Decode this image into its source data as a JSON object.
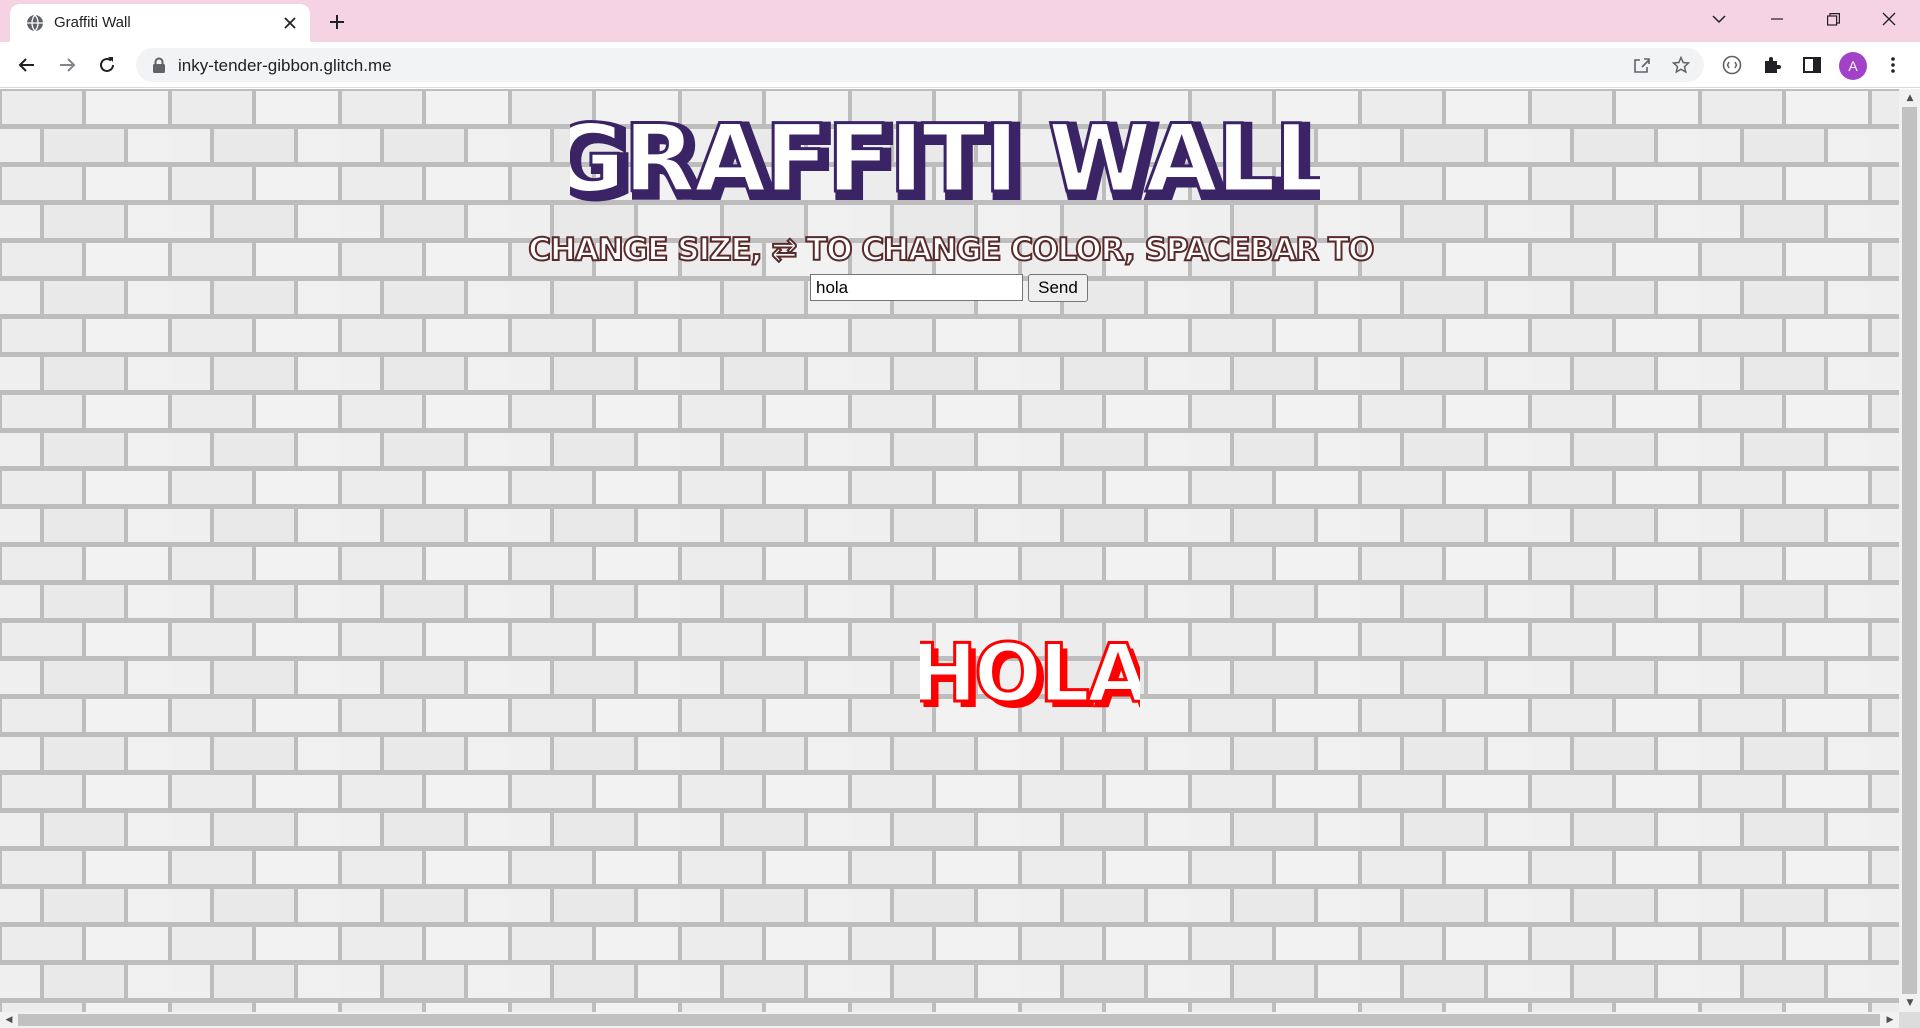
{
  "browser": {
    "tab": {
      "title": "Graffiti Wall",
      "favicon": "globe-icon",
      "close_icon": "close-icon"
    },
    "new_tab_icon": "plus-icon",
    "window_controls": [
      "chevron-down-icon",
      "minimize-icon",
      "restore-icon",
      "close-icon"
    ],
    "nav": [
      "back-icon",
      "forward-icon",
      "reload-icon"
    ],
    "url": "inky-tender-gibbon.glitch.me",
    "omnibox_icons": [
      "share-icon",
      "star-icon"
    ],
    "toolbar_icons": [
      "extension-circle-icon",
      "puzzle-icon",
      "side-panel-icon"
    ],
    "avatar_letter": "A",
    "colors": {
      "tabstrip": "#f6d3e2",
      "avatar": "#a142c9"
    }
  },
  "page": {
    "title": "GRAFFITI WALL",
    "instructions": "↑↓ TO CHANGE SIZE, ⇄ TO CHANGE COLOR, SPACEBAR TO PASTE",
    "input_value": "hola",
    "send_label": "Send",
    "graffiti_text": "HOLA",
    "colors": {
      "title_fill": "#3b2466",
      "instructions_fill": "#5a2a2a",
      "graffiti_fill": "#ff0000"
    }
  }
}
